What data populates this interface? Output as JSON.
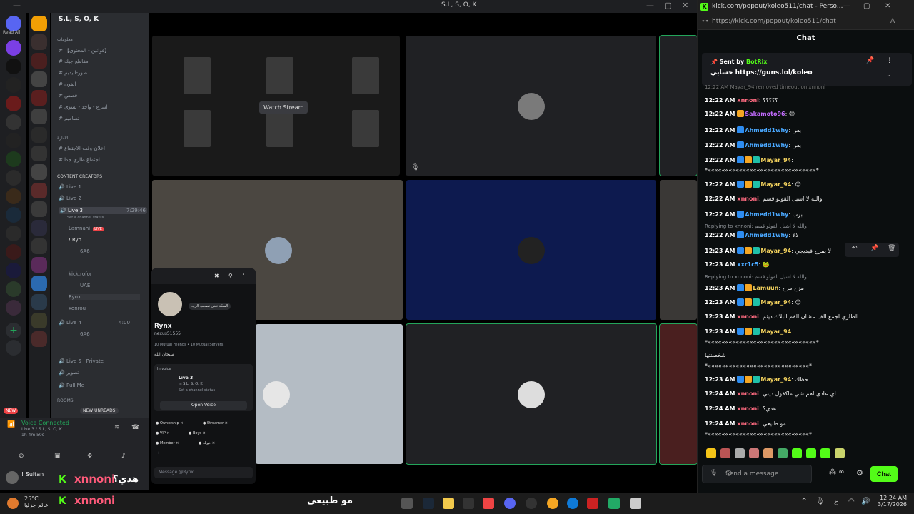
{
  "window": {
    "title": "S.L, S, O, K"
  },
  "discord": {
    "read_all": "Read All",
    "server_name": "S.L, S, O, K",
    "categories": [
      "معلومات",
      "الادارة",
      "CONTENT CREATORS",
      "ROOMS"
    ],
    "text_channels": [
      "【قوانين - المحتوى】",
      "مقاطع-جيك",
      "صور-اليديم",
      "الفون",
      "قصص",
      "اسرع - واحد - يسوي",
      "تصاميم"
    ],
    "admin_channels": [
      "اعلان-وقت-الاجتماع",
      "اجتماع طاري جدا"
    ],
    "voice_channels": [
      "Live 1",
      "Live 2",
      "Live 3",
      "Live 4",
      "Live 5 · Private",
      "تصوير",
      "Pull Me"
    ],
    "live_badge": "LIVE",
    "live3_time": "7:29:46",
    "live4_time": "4:00",
    "set_status": "Set a channel status",
    "members_live3": [
      "Lamnahi",
      "! Ryo",
      "6A6",
      "kick.rofor",
      "UAE",
      "Rynx",
      "xonrou"
    ],
    "members_live4": [
      "6A6"
    ],
    "new_label": "NEW",
    "new_unreads": "NEW UNREADS",
    "voice_connected": "Voice Connected",
    "voice_sub": "Live 3 / S.L, S, O, K",
    "voice_timer": "1h 4m 50s",
    "user_name": "! Sultan",
    "watch_stream": "Watch Stream",
    "profile": {
      "note": "السكة تبغي تصحب الرب",
      "name": "Rynx",
      "tag": "nexus51555",
      "mutual": "10 Mutual Friends • 10 Mutual Servers",
      "bio": "سبحان الله",
      "in_voice_label": "In voice",
      "voice_channel": "Live 3",
      "voice_server": "in S.L, S, O, K",
      "voice_status": "Set a channel status",
      "open_voice": "Open Voice",
      "roles": [
        "Ownership",
        "Streamer",
        "VIP",
        "Boys",
        "Member",
        "خويلد"
      ],
      "message_placeholder": "Message @Rynx"
    }
  },
  "ticker": {
    "user1": "xnnoni",
    "text1": "هدي؟",
    "user2": "xnnoni",
    "text2": "مو طبيعي",
    "kick_logo": "K"
  },
  "taskbar": {
    "temp": "25°C",
    "weather": "غائم جزئيا",
    "lang": "ع",
    "time": "12:24 AM",
    "date": "3/17/2026"
  },
  "browser": {
    "tab_title": "kick.com/popout/koleo511/chat - Perso...",
    "url": "https://kick.com/popout/koleo511/chat",
    "chat_header": "Chat",
    "pinned_sent_by": "Sent by",
    "pinned_bot": "BotRix",
    "pinned_text": "حسابي https://guns.lol/koleo",
    "send_placeholder": "Send a message",
    "chat_button": "Chat",
    "top_notice": "12:22 AM Mayar_94 removed timeout on xnnoni"
  },
  "colors": {
    "kick_green": "#53fc18",
    "discord_green": "#23a55a",
    "live_red": "#ed4245"
  },
  "messages": [
    {
      "time": "12:22 AM",
      "user": "xnnoni",
      "color": "#ff6b81",
      "badges": [],
      "text": "؟؟؟؟؟"
    },
    {
      "time": "12:22 AM",
      "user": "Sakamoto96",
      "color": "#c36bff",
      "badges": [
        "#f5a623"
      ],
      "text": "😊"
    },
    {
      "time": "12:22 AM",
      "user": "Ahmedd1why",
      "color": "#4aa8ff",
      "badges": [
        "#2d8cf0"
      ],
      "text": "بس"
    },
    {
      "time": "12:22 AM",
      "user": "Ahmedd1why",
      "color": "#4aa8ff",
      "badges": [
        "#2d8cf0"
      ],
      "text": "بس"
    },
    {
      "time": "12:22 AM",
      "user": "Mayar_94",
      "color": "#f4d35e",
      "badges": [
        "#2d8cf0",
        "#f5a623",
        "#1fc0a8"
      ],
      "text": ""
    },
    {
      "time": "",
      "user": "",
      "color": "#eee",
      "badges": [],
      "text": "*«««««««««««««««««««««««««««««««*"
    },
    {
      "time": "12:22 AM",
      "user": "Mayar_94",
      "color": "#f4d35e",
      "badges": [
        "#2d8cf0",
        "#f5a623",
        "#1fc0a8"
      ],
      "text": "😊"
    },
    {
      "time": "12:22 AM",
      "user": "xnnoni",
      "color": "#ff6b81",
      "badges": [],
      "text": "والله لا اشيل القولو قسم"
    },
    {
      "time": "12:22 AM",
      "user": "Ahmedd1why",
      "color": "#4aa8ff",
      "badges": [
        "#2d8cf0"
      ],
      "text": "برب"
    },
    {
      "reply": "Replying to xnnoni: والله لا اشيل القولو قسم"
    },
    {
      "time": "12:22 AM",
      "user": "Ahmedd1why",
      "color": "#4aa8ff",
      "badges": [
        "#2d8cf0"
      ],
      "text": "لالا"
    },
    {
      "time": "12:23 AM",
      "user": "Mayar_94",
      "color": "#f4d35e",
      "badges": [
        "#2d8cf0",
        "#f5a623",
        "#1fc0a8"
      ],
      "text": "لا يمزح فيديجي"
    },
    {
      "time": "12:23 AM",
      "user": "xxr1c5",
      "color": "#4aa8ff",
      "badges": [],
      "text": "🐸"
    },
    {
      "reply": "Replying to xnnoni: والله لا اشيل القولو قسم"
    },
    {
      "time": "12:23 AM",
      "user": "Lamuun",
      "color": "#f4d35e",
      "badges": [
        "#2d8cf0",
        "#f5a623"
      ],
      "text": "مزح مزح"
    },
    {
      "time": "12:23 AM",
      "user": "Mayar_94",
      "color": "#f4d35e",
      "badges": [
        "#2d8cf0",
        "#f5a623",
        "#1fc0a8"
      ],
      "text": "😊"
    },
    {
      "time": "12:23 AM",
      "user": "xnnoni",
      "color": "#ff6b81",
      "badges": [],
      "text": "الطاري اجمع الف عشان الفم البلاك ديثم"
    },
    {
      "time": "12:23 AM",
      "user": "Mayar_94",
      "color": "#f4d35e",
      "badges": [
        "#2d8cf0",
        "#f5a623",
        "#1fc0a8"
      ],
      "text": ""
    },
    {
      "time": "",
      "user": "",
      "color": "#eee",
      "badges": [],
      "text": "*«««««««««««««««««««««««««««««««*"
    },
    {
      "time": "",
      "user": "",
      "color": "#eee",
      "badges": [],
      "text": "شخصنتها"
    },
    {
      "time": "",
      "user": "",
      "color": "#eee",
      "badges": [],
      "text": "*«««««««««««««««««««««««««««««*"
    },
    {
      "time": "12:23 AM",
      "user": "Mayar_94",
      "color": "#f4d35e",
      "badges": [
        "#2d8cf0",
        "#f5a623",
        "#1fc0a8"
      ],
      "text": "حظك"
    },
    {
      "time": "12:24 AM",
      "user": "xnnoni",
      "color": "#ff6b81",
      "badges": [],
      "text": "اي عادي اهم شي ماكفول ديني"
    },
    {
      "time": "12:24 AM",
      "user": "xnnoni",
      "color": "#ff6b81",
      "badges": [],
      "text": "هدي؟"
    },
    {
      "time": "12:24 AM",
      "user": "xnnoni",
      "color": "#ff6b81",
      "badges": [],
      "text": "مو طبيعي"
    },
    {
      "time": "",
      "user": "",
      "color": "#eee",
      "badges": [],
      "text": "*«««««««««««««««««««««««««««««*"
    }
  ]
}
